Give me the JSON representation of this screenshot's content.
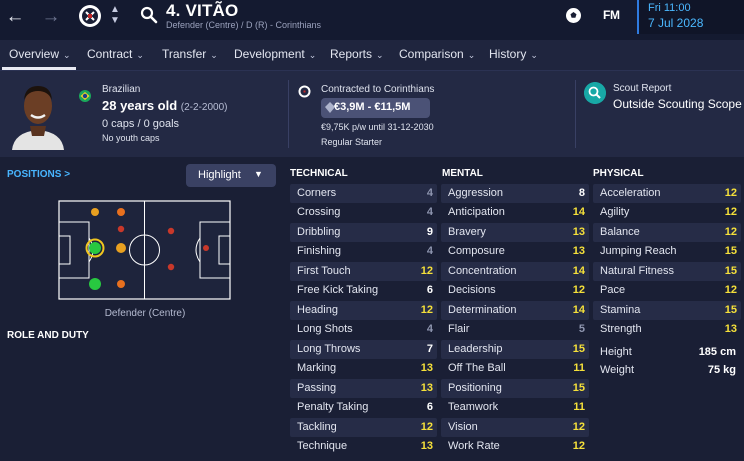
{
  "titlebar": {
    "player_name": "4. VITÃO",
    "player_subtitle": "Defender (Centre) / D (R) - Corinthians",
    "brand": "FM",
    "date_day": "Fri 11:00",
    "date_full": "7 Jul 2028",
    "icons": [
      "arrow-left-icon",
      "arrow-right-icon",
      "club-crest-icon",
      "chevron-up-down-icon",
      "search-icon",
      "ball-icon"
    ]
  },
  "tabs": [
    {
      "label": "Overview"
    },
    {
      "label": "Contract"
    },
    {
      "label": "Transfer"
    },
    {
      "label": "Development"
    },
    {
      "label": "Reports"
    },
    {
      "label": "Comparison"
    },
    {
      "label": "History"
    }
  ],
  "profile": {
    "nationality": "Brazilian",
    "age": "28 years old",
    "dob": "(2-2-2000)",
    "caps": "0 caps / 0 goals",
    "youth": "No youth caps"
  },
  "contract": {
    "title": "Contracted to Corinthians",
    "value_range": "€3,9M - €11,5M",
    "wage": "€9,75K p/w until 31-12-2030",
    "status": "Regular Starter"
  },
  "scout": {
    "title": "Scout Report",
    "value": "Outside Scouting Scope"
  },
  "positions": {
    "link": "POSITIONS >",
    "dropdown": "Highlight",
    "label": "Defender (Centre)",
    "role_title": "ROLE AND DUTY"
  },
  "attributes": {
    "technical": {
      "title": "TECHNICAL",
      "items": [
        {
          "name": "Corners",
          "value": "4"
        },
        {
          "name": "Crossing",
          "value": "4"
        },
        {
          "name": "Dribbling",
          "value": "9"
        },
        {
          "name": "Finishing",
          "value": "4"
        },
        {
          "name": "First Touch",
          "value": "12"
        },
        {
          "name": "Free Kick Taking",
          "value": "6"
        },
        {
          "name": "Heading",
          "value": "12"
        },
        {
          "name": "Long Shots",
          "value": "4"
        },
        {
          "name": "Long Throws",
          "value": "7"
        },
        {
          "name": "Marking",
          "value": "13"
        },
        {
          "name": "Passing",
          "value": "13"
        },
        {
          "name": "Penalty Taking",
          "value": "6"
        },
        {
          "name": "Tackling",
          "value": "12"
        },
        {
          "name": "Technique",
          "value": "13"
        }
      ]
    },
    "mental": {
      "title": "MENTAL",
      "items": [
        {
          "name": "Aggression",
          "value": "8"
        },
        {
          "name": "Anticipation",
          "value": "14"
        },
        {
          "name": "Bravery",
          "value": "13"
        },
        {
          "name": "Composure",
          "value": "13"
        },
        {
          "name": "Concentration",
          "value": "14"
        },
        {
          "name": "Decisions",
          "value": "12"
        },
        {
          "name": "Determination",
          "value": "14"
        },
        {
          "name": "Flair",
          "value": "5"
        },
        {
          "name": "Leadership",
          "value": "15"
        },
        {
          "name": "Off The Ball",
          "value": "11"
        },
        {
          "name": "Positioning",
          "value": "15"
        },
        {
          "name": "Teamwork",
          "value": "11"
        },
        {
          "name": "Vision",
          "value": "12"
        },
        {
          "name": "Work Rate",
          "value": "12"
        }
      ]
    },
    "physical": {
      "title": "PHYSICAL",
      "items": [
        {
          "name": "Acceleration",
          "value": "12"
        },
        {
          "name": "Agility",
          "value": "12"
        },
        {
          "name": "Balance",
          "value": "12"
        },
        {
          "name": "Jumping Reach",
          "value": "15"
        },
        {
          "name": "Natural Fitness",
          "value": "15"
        },
        {
          "name": "Pace",
          "value": "12"
        },
        {
          "name": "Stamina",
          "value": "15"
        },
        {
          "name": "Strength",
          "value": "13"
        }
      ],
      "measurements": [
        {
          "name": "Height",
          "value": "185 cm"
        },
        {
          "name": "Weight",
          "value": "75 kg"
        }
      ]
    }
  },
  "colors": {
    "value_low": "#8f96b0",
    "value_mid": "#ffffff",
    "value_high": "#f5e03a",
    "accent": "#48b5ff"
  }
}
